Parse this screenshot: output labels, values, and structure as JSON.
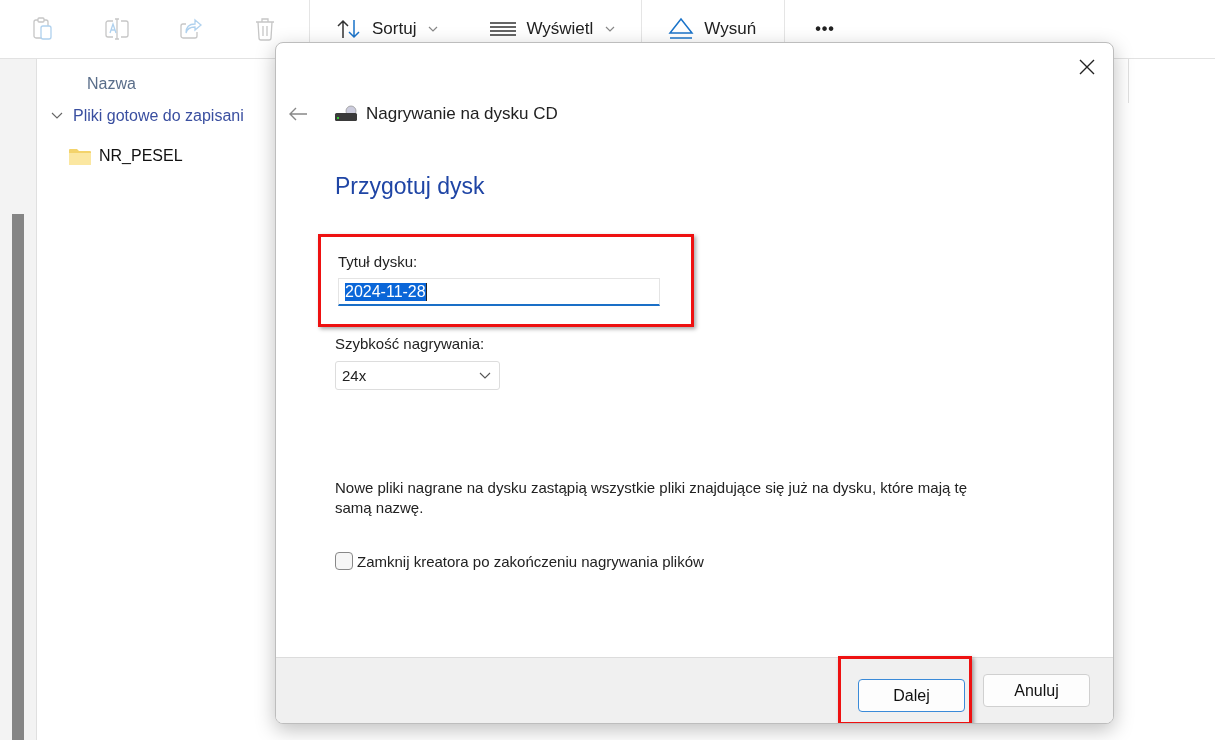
{
  "toolbar": {
    "icon_buttons": [
      {
        "kind": "paste",
        "disabled": true
      },
      {
        "kind": "rename",
        "disabled": true
      },
      {
        "kind": "share",
        "disabled": true
      },
      {
        "kind": "delete",
        "disabled": true
      }
    ],
    "menus": [
      {
        "kind": "sort",
        "label": "Sortuj",
        "dropdown": true
      },
      {
        "kind": "view",
        "label": "Wyświetl",
        "dropdown": true
      },
      {
        "kind": "eject",
        "label": "Wysuń",
        "dropdown": false
      }
    ],
    "more": "•••"
  },
  "explorer": {
    "column_header": "Nazwa",
    "group": {
      "label": "Pliki gotowe do zapisani",
      "expanded": true,
      "children": [
        {
          "name": "NR_PESEL"
        }
      ]
    }
  },
  "dialog": {
    "title": "Nagrywanie na dysku CD",
    "heading": "Przygotuj dysk",
    "title_field": {
      "label": "Tytuł dysku:",
      "value": "2024-11-28",
      "text_selected": true,
      "highlighted": true
    },
    "speed": {
      "label": "Szybkość nagrywania:",
      "value": "24x"
    },
    "note": "Nowe pliki nagrane na dysku zastąpią wszystkie pliki znajdujące się już na dysku, które mają tę samą nazwę.",
    "close_checkbox": {
      "label": "Zamknij kreatora po zakończeniu nagrywania plików",
      "checked": false
    },
    "buttons": [
      {
        "label": "Dalej",
        "default": true,
        "highlighted": true
      },
      {
        "label": "Anuluj",
        "default": false,
        "highlighted": false
      }
    ]
  }
}
